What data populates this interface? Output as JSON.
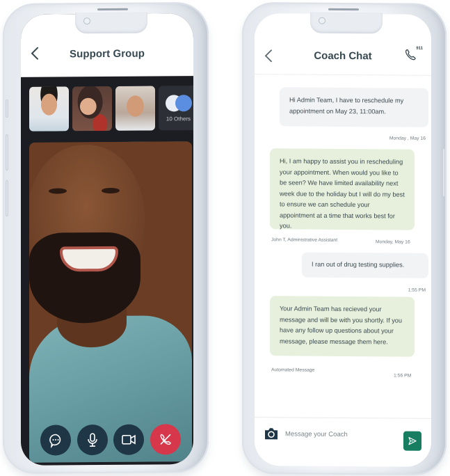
{
  "support_group": {
    "title": "Support Group",
    "back_icon": "chevron-left-icon",
    "participants": [
      {
        "name": "participant-1"
      },
      {
        "name": "participant-2"
      },
      {
        "name": "participant-3"
      }
    ],
    "others_label": "10 Others",
    "controls": [
      {
        "icon": "chat-bubble-icon",
        "label": "Chat"
      },
      {
        "icon": "microphone-icon",
        "label": "Mute"
      },
      {
        "icon": "video-camera-icon",
        "label": "Video"
      },
      {
        "icon": "end-call-icon",
        "label": "End call"
      }
    ],
    "colors": {
      "control_bg": "#1f3646",
      "end_call": "#d7374a",
      "others_dot_blue": "#5b8de0"
    }
  },
  "coach_chat": {
    "title": "Coach Chat",
    "back_icon": "chevron-left-icon",
    "call_badge": "911",
    "messages": [
      {
        "type": "outgoing",
        "text": "Hi Admin Team, I have to reschedule my appointment on May 23, 11:00am.",
        "time": "Monday , May 16"
      },
      {
        "type": "incoming",
        "text": "Hi, I am happy to assist you in rescheduling your appointment. When would you like to be seen? We have limited availability next week due to the holiday but I will do my best to ensure we can schedule your appointment at a time that works best for you.",
        "sender": "John T, Administrative Assistant",
        "time": "Monday, May 16"
      },
      {
        "type": "outgoing",
        "text": "I ran out of drug testing supplies.",
        "time": "1:55 PM"
      },
      {
        "type": "incoming",
        "text": "Your Admin Team has recieved your message and will be with you shortly. If you have any follow up questions about your message, please message them here.",
        "sender": "Automated Message",
        "time": "1:56 PM"
      }
    ],
    "composer": {
      "placeholder": "Message your Coach",
      "value": ""
    },
    "colors": {
      "incoming_bubble": "#e6f0dc",
      "outgoing_bubble": "#f2f3f5",
      "send_button": "#177e62"
    }
  }
}
